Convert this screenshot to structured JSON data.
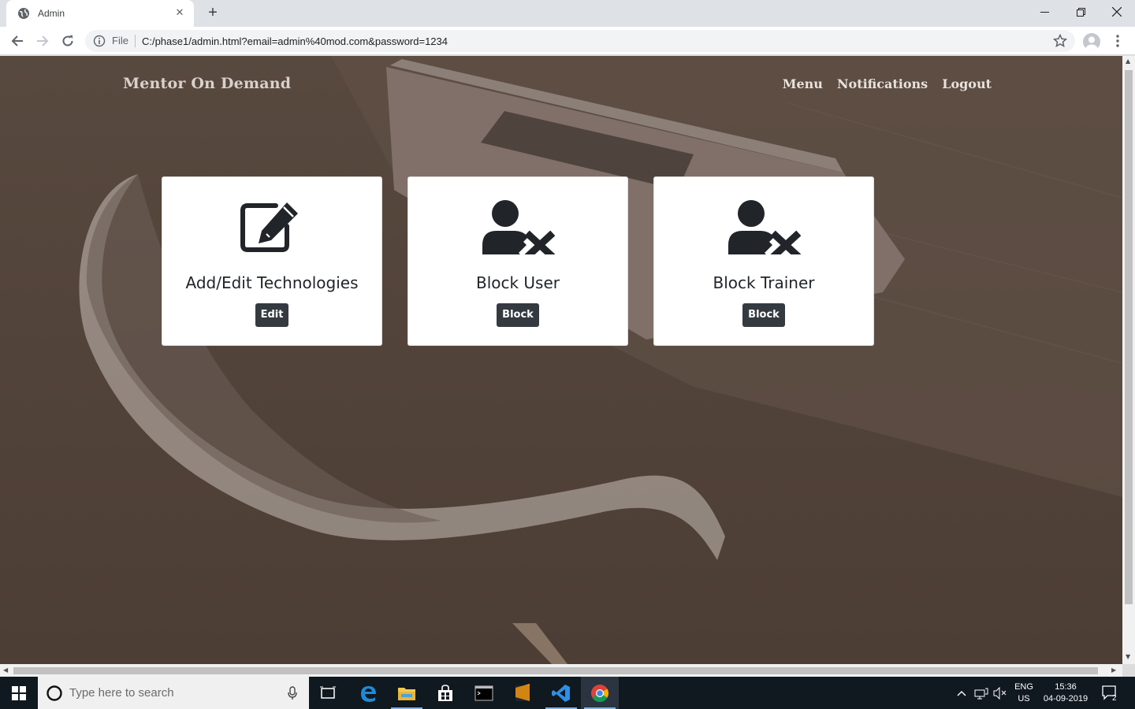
{
  "browser": {
    "tab_title": "Admin",
    "url_scheme_label": "File",
    "url": "C:/phase1/admin.html?email=admin%40mod.com&password=1234"
  },
  "app": {
    "brand": "Mentor On Demand",
    "nav": [
      {
        "label": "Menu"
      },
      {
        "label": "Notifications"
      },
      {
        "label": "Logout"
      }
    ]
  },
  "cards": [
    {
      "title": "Add/Edit Technologies",
      "button": "Edit",
      "icon": "edit-icon"
    },
    {
      "title": "Block User",
      "button": "Block",
      "icon": "user-times-icon"
    },
    {
      "title": "Block Trainer",
      "button": "Block",
      "icon": "user-times-icon"
    }
  ],
  "taskbar": {
    "search_placeholder": "Type here to search",
    "lang_top": "ENG",
    "lang_bottom": "US",
    "time": "15:36",
    "date": "04-09-2019",
    "notification_count": "2"
  },
  "colors": {
    "page_bg": "#50413a",
    "button": "#343a40",
    "card": "#ffffff"
  }
}
